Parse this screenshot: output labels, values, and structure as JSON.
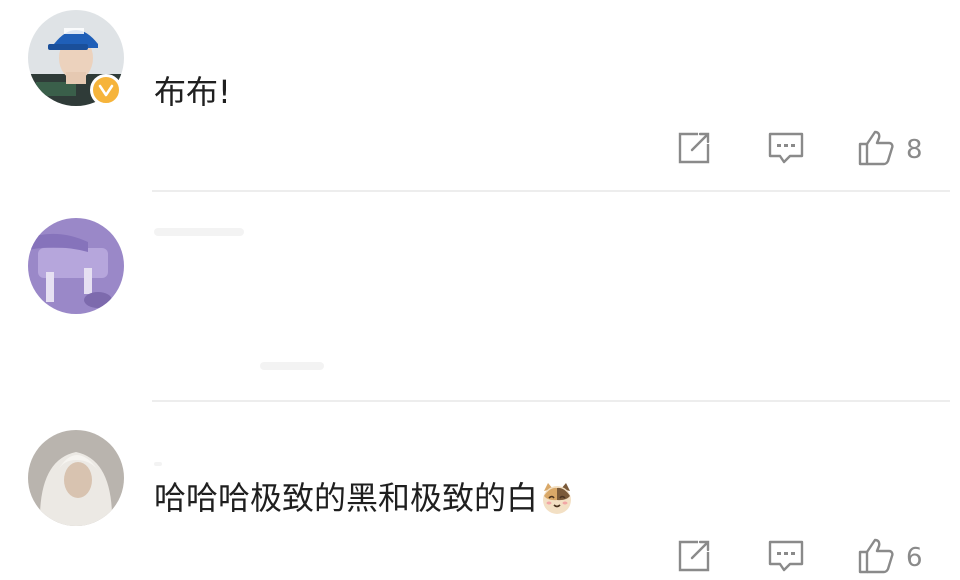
{
  "comments": [
    {
      "text": "布布!",
      "verified": true,
      "like_count": "8",
      "avatar": "avatar-man-blue-cap"
    },
    {
      "text": "哈哈哈极致的黑和极致的白",
      "emoji": "cat-emoji",
      "like_count": "6",
      "avatar": "avatar-purple-figure"
    },
    {
      "avatar": "avatar-blonde-hair"
    }
  ],
  "icons": {
    "share": "share-icon",
    "comment": "comment-icon",
    "like": "thumbs-up-icon",
    "verified": "verified-badge-icon"
  },
  "colors": {
    "text": "#1f1f1f",
    "icon_gray": "#8a8a8a",
    "badge_orange": "#f6b43b",
    "divider": "#ededed"
  }
}
